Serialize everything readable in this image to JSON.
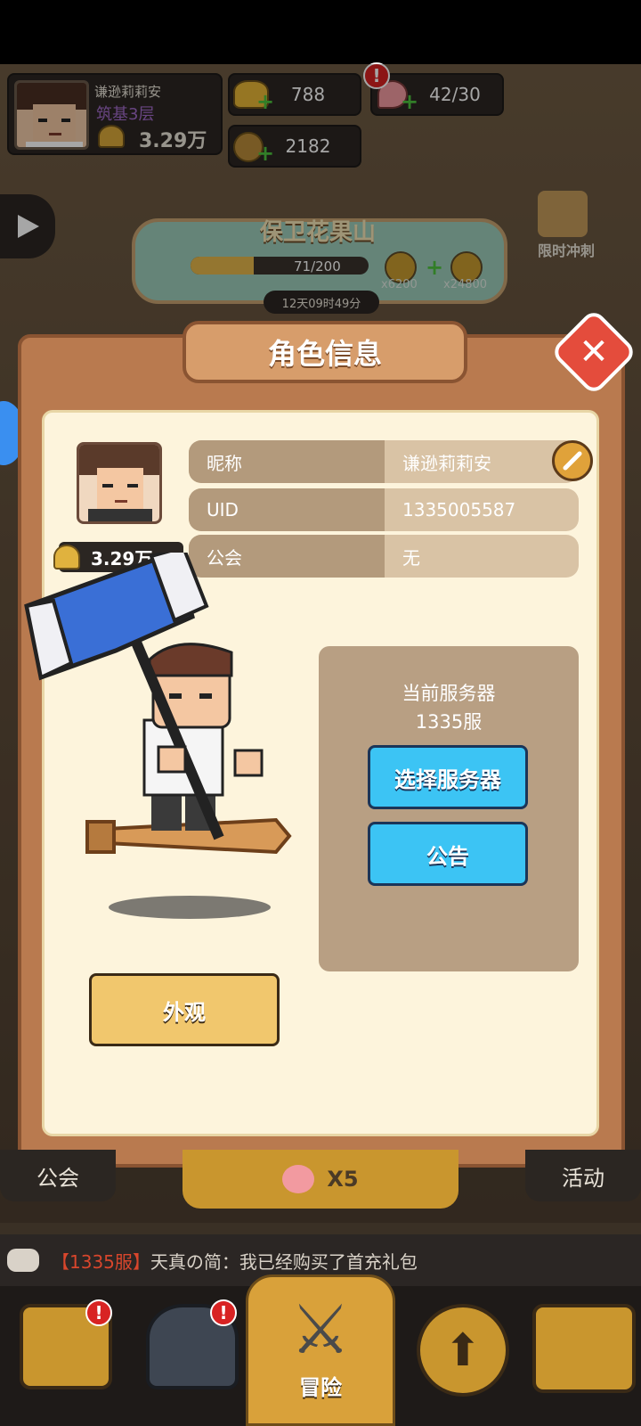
{
  "top_bar": {
    "player_name": "谦逊莉莉安",
    "realm": "筑基3层",
    "power": "3.29万",
    "gold": "788",
    "stamina": "42/30",
    "stamina_badge": "!",
    "copper": "2182"
  },
  "event_banner": {
    "title": "保卫花果山",
    "progress": "71/200",
    "progress_fraction": 0.355,
    "reward_left": "x6200",
    "reward_right": "x24800",
    "timer": "12天09时49分",
    "limited_sprint": "限时冲刺"
  },
  "modal": {
    "title": "角色信息",
    "close_icon": "close-icon",
    "nickname_label": "昵称",
    "nickname_value": "谦逊莉莉安",
    "uid_label": "UID",
    "uid_value": "1335005587",
    "guild_label": "公会",
    "guild_value": "无",
    "power_badge": "3.29万",
    "server_panel": {
      "current_server_label": "当前服务器",
      "current_server_value": "1335服",
      "select_server_button": "选择服务器",
      "announcement_button": "公告"
    },
    "appearance_button": "外观"
  },
  "bottom": {
    "guild_tab": "公会",
    "center_multiplier": "X5",
    "activity_tab": "活动",
    "chat_server": "【1335服】",
    "chat_message": "天真の简：我已经购买了首充礼包",
    "adventure_label": "冒险"
  },
  "colors": {
    "modal_bg": "#b97a4f",
    "inner_bg": "#fdf4dc",
    "blue_button": "#3cc4f4",
    "gold_button": "#f1c76d",
    "close_red": "#e44c3c"
  }
}
